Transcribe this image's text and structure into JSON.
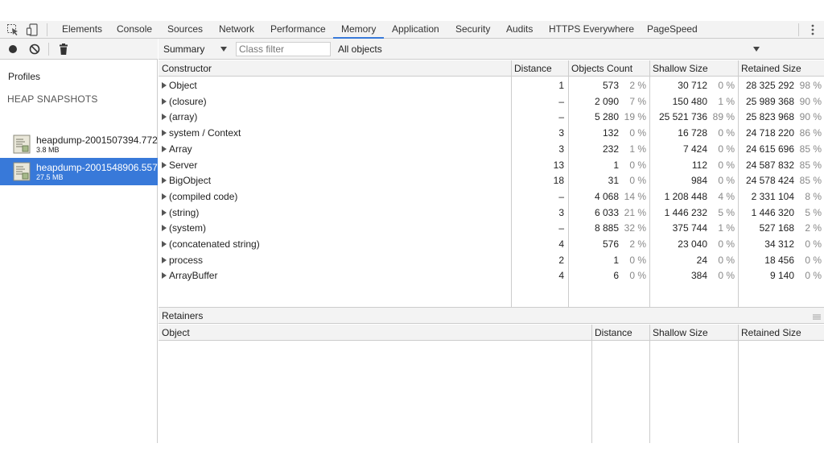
{
  "tabs": [
    {
      "label": "Elements",
      "active": false
    },
    {
      "label": "Console",
      "active": false
    },
    {
      "label": "Sources",
      "active": false
    },
    {
      "label": "Network",
      "active": false
    },
    {
      "label": "Performance",
      "active": false
    },
    {
      "label": "Memory",
      "active": true
    },
    {
      "label": "Application",
      "active": false
    },
    {
      "label": "Security",
      "active": false
    },
    {
      "label": "Audits",
      "active": false
    },
    {
      "label": "HTTPS Everywhere",
      "active": false
    },
    {
      "label": "PageSpeed",
      "active": false
    }
  ],
  "sidebar": {
    "profiles_title": "Profiles",
    "section_title": "HEAP SNAPSHOTS",
    "snapshots": [
      {
        "name": "heapdump-2001507394.772",
        "size": "3.8 MB",
        "selected": false
      },
      {
        "name": "heapdump-2001548906.557",
        "size": "27.5 MB",
        "selected": true
      }
    ]
  },
  "toolbar": {
    "view": "Summary",
    "class_filter_placeholder": "Class filter",
    "class_filter_value": "",
    "scope": "All objects"
  },
  "summary": {
    "columns": [
      "Constructor",
      "Distance",
      "Objects Count",
      "Shallow Size",
      "Retained Size"
    ],
    "rows": [
      {
        "name": "Object",
        "distance": "1",
        "count": "573",
        "count_pct": "2 %",
        "shallow": "30 712",
        "shallow_pct": "0 %",
        "retained": "28 325 292",
        "retained_pct": "98 %"
      },
      {
        "name": "(closure)",
        "distance": "–",
        "count": "2 090",
        "count_pct": "7 %",
        "shallow": "150 480",
        "shallow_pct": "1 %",
        "retained": "25 989 368",
        "retained_pct": "90 %"
      },
      {
        "name": "(array)",
        "distance": "–",
        "count": "5 280",
        "count_pct": "19 %",
        "shallow": "25 521 736",
        "shallow_pct": "89 %",
        "retained": "25 823 968",
        "retained_pct": "90 %"
      },
      {
        "name": "system / Context",
        "distance": "3",
        "count": "132",
        "count_pct": "0 %",
        "shallow": "16 728",
        "shallow_pct": "0 %",
        "retained": "24 718 220",
        "retained_pct": "86 %"
      },
      {
        "name": "Array",
        "distance": "3",
        "count": "232",
        "count_pct": "1 %",
        "shallow": "7 424",
        "shallow_pct": "0 %",
        "retained": "24 615 696",
        "retained_pct": "85 %"
      },
      {
        "name": "Server",
        "distance": "13",
        "count": "1",
        "count_pct": "0 %",
        "shallow": "112",
        "shallow_pct": "0 %",
        "retained": "24 587 832",
        "retained_pct": "85 %"
      },
      {
        "name": "BigObject",
        "distance": "18",
        "count": "31",
        "count_pct": "0 %",
        "shallow": "984",
        "shallow_pct": "0 %",
        "retained": "24 578 424",
        "retained_pct": "85 %"
      },
      {
        "name": "(compiled code)",
        "distance": "–",
        "count": "4 068",
        "count_pct": "14 %",
        "shallow": "1 208 448",
        "shallow_pct": "4 %",
        "retained": "2 331 104",
        "retained_pct": "8 %"
      },
      {
        "name": "(string)",
        "distance": "3",
        "count": "6 033",
        "count_pct": "21 %",
        "shallow": "1 446 232",
        "shallow_pct": "5 %",
        "retained": "1 446 320",
        "retained_pct": "5 %"
      },
      {
        "name": "(system)",
        "distance": "–",
        "count": "8 885",
        "count_pct": "32 %",
        "shallow": "375 744",
        "shallow_pct": "1 %",
        "retained": "527 168",
        "retained_pct": "2 %"
      },
      {
        "name": "(concatenated string)",
        "distance": "4",
        "count": "576",
        "count_pct": "2 %",
        "shallow": "23 040",
        "shallow_pct": "0 %",
        "retained": "34 312",
        "retained_pct": "0 %"
      },
      {
        "name": "process",
        "distance": "2",
        "count": "1",
        "count_pct": "0 %",
        "shallow": "24",
        "shallow_pct": "0 %",
        "retained": "18 456",
        "retained_pct": "0 %"
      },
      {
        "name": "ArrayBuffer",
        "distance": "4",
        "count": "6",
        "count_pct": "0 %",
        "shallow": "384",
        "shallow_pct": "0 %",
        "retained": "9 140",
        "retained_pct": "0 %"
      }
    ]
  },
  "retainers": {
    "title": "Retainers",
    "columns": [
      "Object",
      "Distance",
      "Shallow Size",
      "Retained Size"
    ]
  },
  "icons": {
    "inspect": "inspect-element-icon",
    "device": "device-toolbar-icon",
    "record": "record-icon",
    "clear": "clear-icon",
    "trash": "trash-icon",
    "more": "more-vertical-icon",
    "snapshot": "heap-snapshot-icon"
  },
  "colors": {
    "accent": "#3879d9",
    "toolbar_bg": "#f3f3f3",
    "border": "#cccccc"
  }
}
